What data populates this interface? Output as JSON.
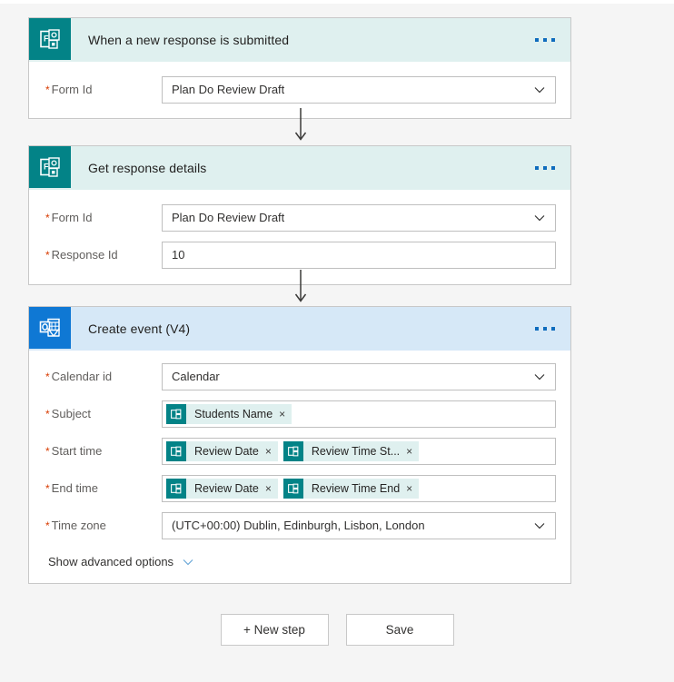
{
  "theme": {
    "page_background": "#f5f5f5",
    "forms_accent": "#038387",
    "outlook_accent": "#0f78d4",
    "forms_header_background": "#dff0ef",
    "outlook_header_background": "#d6e8f7",
    "required_marker_color": "#d83b01",
    "link_color": "#0f6cbd"
  },
  "flow": {
    "steps": [
      {
        "id": "trigger",
        "title": "When a new response is submitted",
        "connector_icon": "microsoft-forms-icon",
        "header_style": "teal",
        "overflow_label": "...",
        "fields": [
          {
            "label": "Form Id",
            "required": true,
            "type": "dropdown",
            "value": "Plan Do Review Draft",
            "icon": "chevron-down-icon"
          }
        ]
      },
      {
        "id": "get-response-details",
        "title": "Get response details",
        "connector_icon": "microsoft-forms-icon",
        "header_style": "teal",
        "overflow_label": "...",
        "fields": [
          {
            "label": "Form Id",
            "required": true,
            "type": "dropdown",
            "value": "Plan Do Review Draft",
            "icon": "chevron-down-icon"
          },
          {
            "label": "Response Id",
            "required": true,
            "type": "text",
            "value": "10"
          }
        ]
      },
      {
        "id": "create-event-v4",
        "title": "Create event (V4)",
        "connector_icon": "outlook-calendar-icon",
        "header_style": "blue",
        "overflow_label": "...",
        "fields": [
          {
            "label": "Calendar id",
            "required": true,
            "type": "dropdown",
            "value": "Calendar",
            "icon": "chevron-down-icon"
          },
          {
            "label": "Subject",
            "required": true,
            "type": "tokens",
            "tokens": [
              {
                "label": "Students Name",
                "icon": "microsoft-forms-icon",
                "remove": "×"
              }
            ]
          },
          {
            "label": "Start time",
            "required": true,
            "type": "tokens",
            "tokens": [
              {
                "label": "Review Date",
                "icon": "microsoft-forms-icon",
                "remove": "×"
              },
              {
                "label": "Review Time St...",
                "icon": "microsoft-forms-icon",
                "remove": "×"
              }
            ]
          },
          {
            "label": "End time",
            "required": true,
            "type": "tokens",
            "tokens": [
              {
                "label": "Review Date",
                "icon": "microsoft-forms-icon",
                "remove": "×"
              },
              {
                "label": "Review Time End",
                "icon": "microsoft-forms-icon",
                "remove": "×"
              }
            ]
          },
          {
            "label": "Time zone",
            "required": true,
            "type": "dropdown",
            "value": "(UTC+00:00) Dublin, Edinburgh, Lisbon, London",
            "icon": "chevron-down-icon"
          }
        ],
        "advanced_options": {
          "label": "Show advanced options",
          "icon": "chevron-down-icon"
        }
      }
    ]
  },
  "actions": {
    "new_step_label": "+ New step",
    "save_label": "Save"
  }
}
